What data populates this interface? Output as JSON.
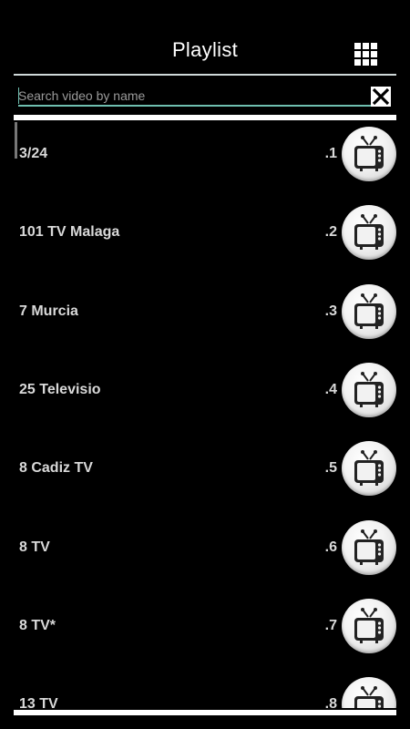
{
  "header": {
    "title": "Playlist",
    "grid_icon": "grid-view-icon"
  },
  "search": {
    "placeholder": "Search video by name",
    "value": "",
    "clear_icon": "clear-x-icon"
  },
  "channels": [
    {
      "name": "3/24",
      "index": ".1",
      "icon": "tv-icon"
    },
    {
      "name": "101 TV Malaga",
      "index": ".2",
      "icon": "tv-icon"
    },
    {
      "name": "7 Murcia",
      "index": ".3",
      "icon": "tv-icon"
    },
    {
      "name": "25 Televisio",
      "index": ".4",
      "icon": "tv-icon"
    },
    {
      "name": "8 Cadiz TV",
      "index": ".5",
      "icon": "tv-icon"
    },
    {
      "name": "8 TV",
      "index": ".6",
      "icon": "tv-icon"
    },
    {
      "name": "8 TV*",
      "index": ".7",
      "icon": "tv-icon"
    },
    {
      "name": "13 TV",
      "index": ".8",
      "icon": "tv-icon"
    }
  ],
  "colors": {
    "background": "#000000",
    "accent_underline": "#6fbfb0",
    "text": "#d9d9d9"
  }
}
